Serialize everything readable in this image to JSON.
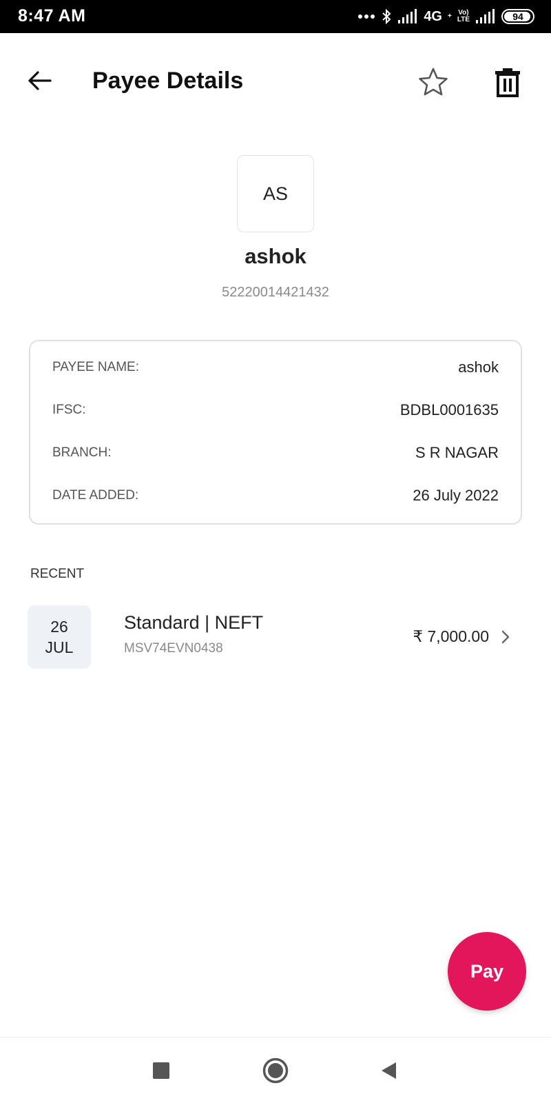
{
  "status_bar": {
    "time": "8:47 AM",
    "network": "4G",
    "network_plus": "+",
    "volte_top": "Vo)",
    "volte_bottom": "LTE",
    "battery": "94"
  },
  "header": {
    "title": "Payee Details"
  },
  "payee": {
    "initials": "AS",
    "name": "ashok",
    "account_number": "52220014421432"
  },
  "details": [
    {
      "label": "PAYEE NAME:",
      "value": "ashok"
    },
    {
      "label": "IFSC:",
      "value": "BDBL0001635"
    },
    {
      "label": "BRANCH:",
      "value": "S R NAGAR"
    },
    {
      "label": "DATE ADDED:",
      "value": "26 July 2022"
    }
  ],
  "recent": {
    "heading": "RECENT",
    "items": [
      {
        "day": "26",
        "month": "JUL",
        "title": "Standard | NEFT",
        "reference": "MSV74EVN0438",
        "amount": "₹ 7,000.00"
      }
    ]
  },
  "actions": {
    "pay_label": "Pay"
  },
  "colors": {
    "accent": "#e3165b",
    "date_box_bg": "#eef1f5",
    "muted_text": "#8a8a8a"
  },
  "icons": {
    "back": "arrow-left-icon",
    "favorite": "star-outline-icon",
    "delete": "trash-icon",
    "chevron": "chevron-right-icon",
    "nav_recents": "square-icon",
    "nav_home": "circle-icon",
    "nav_back": "triangle-left-icon"
  }
}
